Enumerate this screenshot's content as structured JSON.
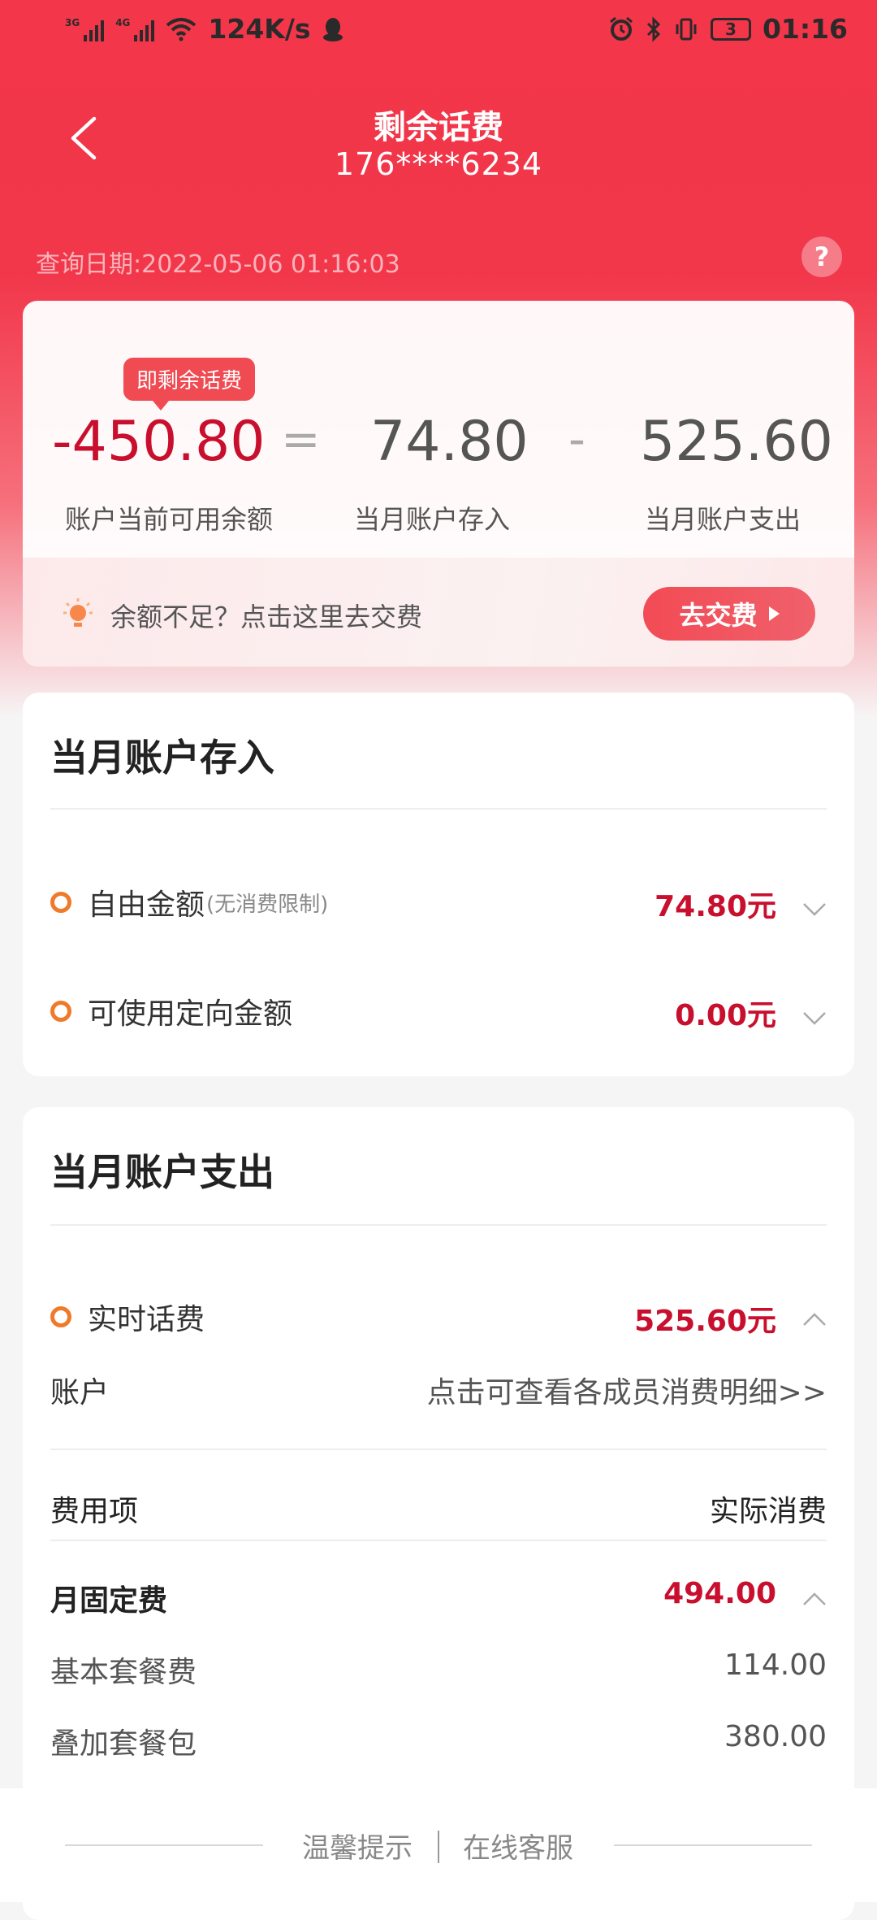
{
  "status_bar": {
    "net1": "3G",
    "net2": "4G",
    "speed": "124K/s",
    "battery": "3",
    "time": "01:16"
  },
  "header": {
    "title": "剩余话费",
    "phone": "176****6234",
    "query_date": "查询日期:2022-05-06 01:16:03",
    "help": "?"
  },
  "summary": {
    "tag": "即剩余话费",
    "balance": "-450.80",
    "eq": "=",
    "income": "74.80",
    "minus": "-",
    "expense": "525.60",
    "balance_label": "账户当前可用余额",
    "income_label": "当月账户存入",
    "expense_label": "当月账户支出",
    "tip": "余额不足？点击这里去交费",
    "pay_button": "去交费"
  },
  "income_section": {
    "title": "当月账户存入",
    "items": [
      {
        "label": "自由金额",
        "note": "(无消费限制)",
        "value": "74.80元"
      },
      {
        "label": "可使用定向金额",
        "note": "",
        "value": "0.00元"
      }
    ]
  },
  "expense_section": {
    "title": "当月账户支出",
    "realtime_label": "实时话费",
    "realtime_value": "525.60元",
    "account_label": "账户",
    "account_link": "点击可查看各成员消费明细>>",
    "col_item": "费用项",
    "col_actual": "实际消费",
    "group_label": "月固定费",
    "group_value": "494.00",
    "rows": [
      {
        "label": "基本套餐费",
        "value": "114.00"
      },
      {
        "label": "叠加套餐包",
        "value": "380.00"
      }
    ]
  },
  "footer": {
    "tips": "温馨提示",
    "service": "在线客服"
  },
  "colors": {
    "brand_red": "#f3364a",
    "amount_red": "#c8102e",
    "dot_orange": "#ef7a2a"
  }
}
